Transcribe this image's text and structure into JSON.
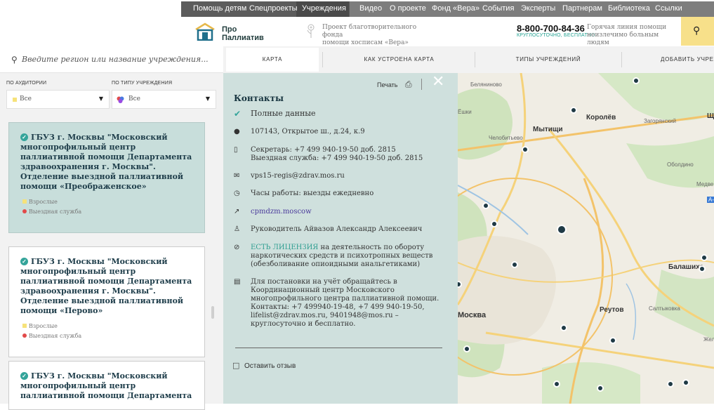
{
  "topnav": {
    "items": [
      "Помощь детям",
      "Спецпроекты",
      "Учреждения",
      "Видео",
      "О проекте",
      "Фонд «Вера»",
      "События",
      "Эксперты",
      "Партнерам",
      "Библиотека",
      "Ссылки"
    ]
  },
  "header": {
    "logo_line1": "Про",
    "logo_line2": "Паллиатив",
    "fund_line1": "Проект благотворительного фонда",
    "fund_line2": "помощи хосписам «Вера»",
    "phone": "8-800-700-84-36",
    "phone_sub": "КРУГЛОСУТОЧНО, БЕСПЛАТНО",
    "hotline_line1": "Горячая линия помощи",
    "hotline_line2": "неизлечимо больным людям",
    "search_icon": "search-icon"
  },
  "search": {
    "placeholder": "Введите регион или название учреждения..."
  },
  "filters": {
    "audience_label": "ПО АУДИТОРИИ",
    "audience_value": "Все",
    "type_label": "ПО ТИПУ УЧРЕЖДЕНИЯ",
    "type_value": "Все"
  },
  "cards": [
    {
      "title": "ГБУЗ г. Москвы \"Московский многопрофильный центр паллиативной помощи Департамента здравоохранения г. Москвы\". Отделение выездной паллиативной помощи «Преображенское»",
      "tag1": "Взрослые",
      "tag2": "Выездная служба"
    },
    {
      "title": "ГБУЗ г. Москвы \"Московский многопрофильный центр паллиативной помощи Департамента здравоохранения г. Москвы\". Отделение выездной паллиативной помощи «Перово»",
      "tag1": "Взрослые",
      "tag2": "Выездная служба"
    },
    {
      "title": "ГБУЗ г. Москвы \"Московский многопрофильный центр паллиативной помощи Департамента",
      "tag1": "",
      "tag2": ""
    }
  ],
  "tabs": [
    "КАРТА",
    "КАК УСТРОЕНА КАРТА",
    "ТИПЫ УЧРЕЖДЕНИЙ",
    "ДОБАВИТЬ УЧРЕЖДЕНИЕ"
  ],
  "contacts": {
    "print_label": "Печать",
    "title": "Контакты",
    "full_data": "Полные данные",
    "address": "107143, Открытое ш., д.24, к.9",
    "phone_line1": "Секретарь: +7 499 940-19-50 доб. 2815",
    "phone_line2": "Выездная служба: +7 499 940-19-50 доб. 2815",
    "email": "vps15-regis@zdrav.mos.ru",
    "hours": "Часы работы: выезды ежедневно",
    "website": "cpmdzm.moscow",
    "head": "Руководитель Айвазов Александр Алексеевич",
    "license_link": "ЕСТЬ ЛИЦЕНЗИЯ",
    "license_rest": " на деятельность по обороту наркотических средств и психотропных веществ (обезболивание опиоидными анальгетиками)",
    "note": "Для постановки на учёт обращайтесь в Координационный центр Московского многопрофильного центра паллиативной помощи. Контакты: +7 499940-19-48, +7 499 940-19-50, lifelist@zdrav.mos.ru, 9401948@mos.ru – круглосуточно и бесплатно.",
    "feedback": "Оставить отзыв"
  },
  "map": {
    "labels": {
      "belyaninovo": "Беляниново",
      "korolev": "Королёв",
      "mytishchi": "Мытищи",
      "zagoryansky": "Загорянский",
      "chelobitevo": "Челобитьево",
      "oboldino": "Оболдино",
      "balashikha": "Балашиха",
      "reutov": "Реутов",
      "saltykovka": "Салтыковка",
      "moskva": "Москва",
      "zheleznodor": "Желе",
      "medve": "Медве",
      "shch": "Щ",
      "yoshkin": "Ёшки",
      "a": "А-"
    }
  }
}
